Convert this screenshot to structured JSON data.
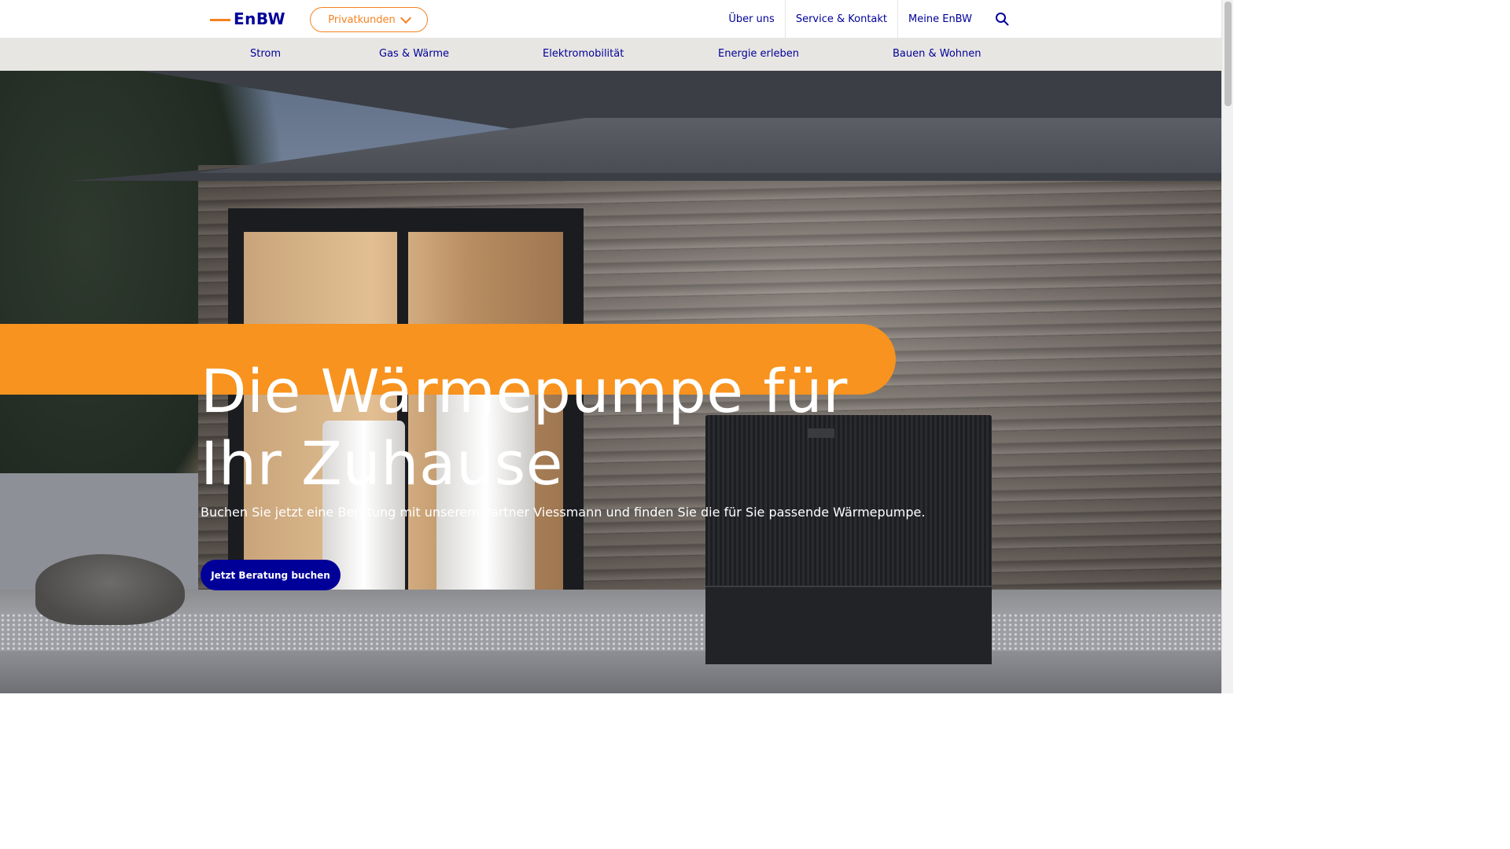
{
  "header": {
    "logo_text": "EnBW",
    "segment_selector": "Privatkunden",
    "top_links": [
      "Über uns",
      "Service & Kontakt",
      "Meine EnBW"
    ],
    "search_icon": "search-icon"
  },
  "mainnav": {
    "items": [
      "Strom",
      "Gas & Wärme",
      "Elektromobilität",
      "Energie erleben",
      "Bauen & Wohnen"
    ]
  },
  "hero": {
    "headline_line1": "Die Wärmepumpe für",
    "headline_line2": "Ihr Zuhause",
    "subline": "Buchen Sie jetzt eine Beratung mit unserem Partner Viessmann und finden Sie die für Sie passende Wärmepumpe.",
    "cta_label": "Jetzt Beratung buchen"
  },
  "colors": {
    "brand_blue": "#000099",
    "brand_orange": "#f7931e",
    "nav_background": "#e8e6e2"
  }
}
